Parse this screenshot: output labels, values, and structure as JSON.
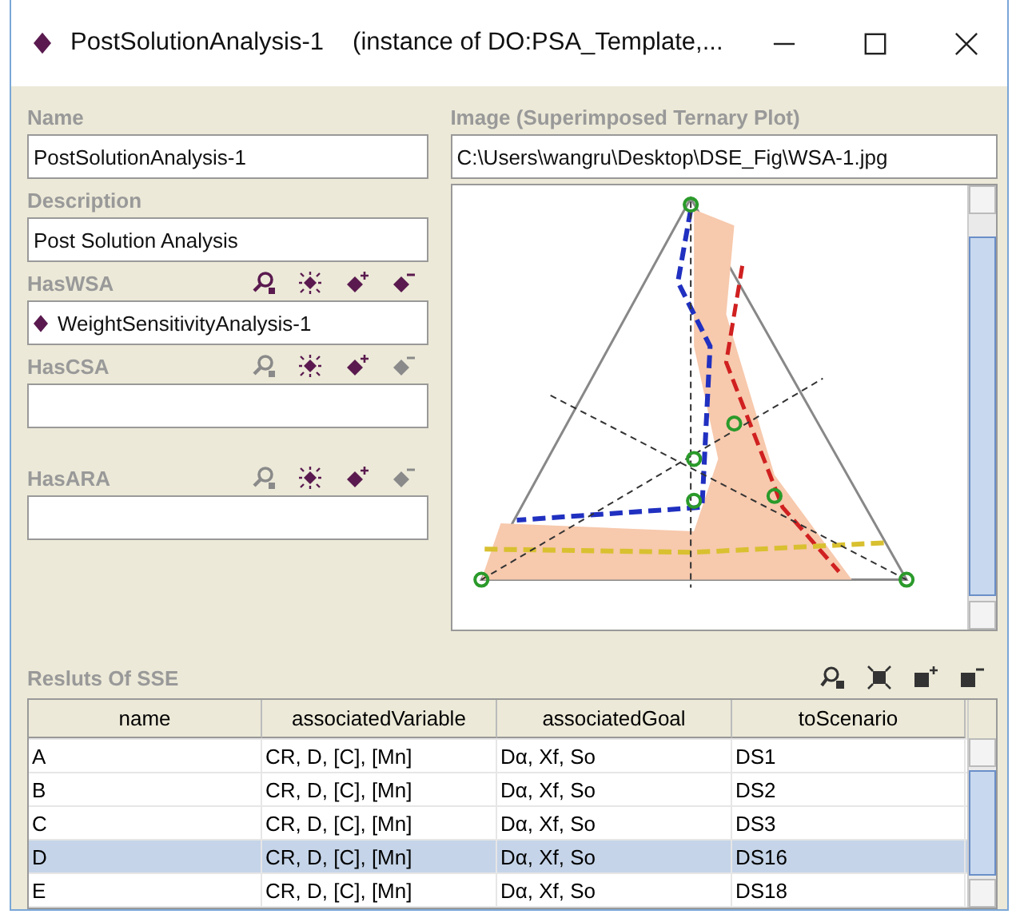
{
  "window": {
    "title": "PostSolutionAnalysis-1",
    "subtitle": "(instance of DO:PSA_Template,..."
  },
  "left_fields": [
    {
      "label": "Name",
      "value": "PostSolutionAnalysis-1"
    },
    {
      "label": "Description",
      "value": "Post Solution Analysis"
    },
    {
      "label": "HasWSA",
      "instance": "WeightSensitivityAnalysis-1",
      "tools": [
        {
          "kind": "find",
          "disabled": false
        },
        {
          "kind": "create",
          "disabled": false
        },
        {
          "kind": "add",
          "disabled": false
        },
        {
          "kind": "remove",
          "disabled": false
        }
      ]
    },
    {
      "label": "HasCSA",
      "tools": [
        {
          "kind": "find",
          "disabled": true
        },
        {
          "kind": "create",
          "disabled": false
        },
        {
          "kind": "add",
          "disabled": false
        },
        {
          "kind": "remove",
          "disabled": true
        }
      ]
    },
    {
      "label": "HasARA",
      "tools": [
        {
          "kind": "find",
          "disabled": true
        },
        {
          "kind": "create",
          "disabled": false
        },
        {
          "kind": "add",
          "disabled": false
        },
        {
          "kind": "remove",
          "disabled": true
        }
      ]
    }
  ],
  "image": {
    "label": "Image (Superimposed Ternary Plot)",
    "path": "C:\\Users\\wangru\\Desktop\\DSE_Fig\\WSA-1.jpg",
    "kind": "picture"
  },
  "table": {
    "title": "Resluts Of SSE",
    "columns": [
      "name",
      "associatedVariable",
      "associatedGoal",
      "toScenario"
    ],
    "rows": [
      {
        "cells": [
          "A",
          "CR, D, [C], [Mn]",
          "Dα, Xf, So",
          "DS1"
        ],
        "selected": false
      },
      {
        "cells": [
          "B",
          "CR, D, [C], [Mn]",
          "Dα, Xf, So",
          "DS2"
        ],
        "selected": false
      },
      {
        "cells": [
          "C",
          "CR, D, [C], [Mn]",
          "Dα, Xf, So",
          "DS3"
        ],
        "selected": false
      },
      {
        "cells": [
          "D",
          "CR, D, [C], [Mn]",
          "Dα, Xf, So",
          "DS16"
        ],
        "selected": true
      },
      {
        "cells": [
          "E",
          "CR, D, [C], [Mn]",
          "Dα, Xf, So",
          "DS18"
        ],
        "selected": false
      }
    ]
  }
}
